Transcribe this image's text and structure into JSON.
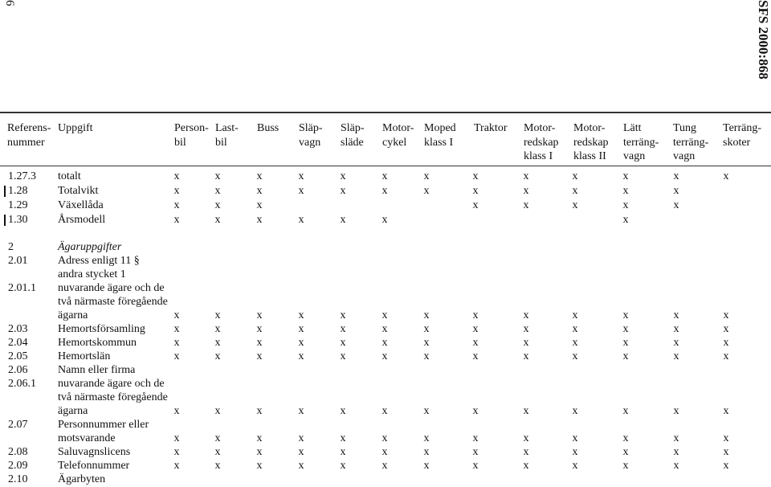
{
  "page_number": "6",
  "doc_id": "SFS 2000:868",
  "header": {
    "ref": "Referens-\nnummer",
    "task": "Uppgift",
    "columns": [
      "Person-\nbil",
      "Last-\nbil",
      "Buss",
      "Släp-\nvagn",
      "Släp-\nsläde",
      "Motor-\ncykel",
      "Moped\nklass I",
      "Traktor",
      "Motor-\nredskap\nklass I",
      "Motor-\nredskap\nklass II",
      "Lätt\nterräng-\nvagn",
      "Tung\nterräng-\nvagn",
      "Terräng-\nskoter"
    ]
  },
  "rows": [
    {
      "ref": "1.27.3",
      "lines": [
        "totalt"
      ],
      "marks": [
        "x",
        "x",
        "x",
        "x",
        "x",
        "x",
        "x",
        "x",
        "x",
        "x",
        "x",
        "x",
        "x"
      ]
    },
    {
      "ref": "1.28",
      "lines": [
        "Totalvikt"
      ],
      "changed": true,
      "marks": [
        "x",
        "x",
        "x",
        "x",
        "x",
        "x",
        "x",
        "x",
        "x",
        "x",
        "x",
        "x",
        ""
      ]
    },
    {
      "ref": "1.29",
      "lines": [
        "Växellåda"
      ],
      "marks": [
        "x",
        "x",
        "x",
        "",
        "",
        "",
        "",
        "x",
        "x",
        "x",
        "x",
        "x",
        ""
      ]
    },
    {
      "ref": "1.30",
      "lines": [
        "Årsmodell"
      ],
      "changed": true,
      "marks": [
        "x",
        "x",
        "x",
        "x",
        "x",
        "x",
        "",
        "",
        "",
        "",
        "x",
        "",
        ""
      ]
    },
    {
      "ref": "2",
      "lines": [
        "Ägaruppgifter"
      ],
      "section": true,
      "marks": []
    },
    {
      "ref": "2.01",
      "lines": [
        "Adress enligt 11 §",
        "andra stycket 1"
      ],
      "marks": []
    },
    {
      "ref": "2.01.1",
      "lines": [
        "nuvarande ägare och de",
        "två närmaste föregående",
        "ägarna"
      ],
      "marks": [
        "x",
        "x",
        "x",
        "x",
        "x",
        "x",
        "x",
        "x",
        "x",
        "x",
        "x",
        "x",
        "x"
      ]
    },
    {
      "ref": "2.03",
      "lines": [
        "Hemortsförsamling"
      ],
      "marks": [
        "x",
        "x",
        "x",
        "x",
        "x",
        "x",
        "x",
        "x",
        "x",
        "x",
        "x",
        "x",
        "x"
      ]
    },
    {
      "ref": "2.04",
      "lines": [
        "Hemortskommun"
      ],
      "marks": [
        "x",
        "x",
        "x",
        "x",
        "x",
        "x",
        "x",
        "x",
        "x",
        "x",
        "x",
        "x",
        "x"
      ]
    },
    {
      "ref": "2.05",
      "lines": [
        "Hemortslän"
      ],
      "marks": [
        "x",
        "x",
        "x",
        "x",
        "x",
        "x",
        "x",
        "x",
        "x",
        "x",
        "x",
        "x",
        "x"
      ]
    },
    {
      "ref": "2.06",
      "lines": [
        "Namn eller firma"
      ],
      "marks": []
    },
    {
      "ref": "2.06.1",
      "lines": [
        "nuvarande ägare och de",
        "två närmaste föregående",
        "ägarna"
      ],
      "marks": [
        "x",
        "x",
        "x",
        "x",
        "x",
        "x",
        "x",
        "x",
        "x",
        "x",
        "x",
        "x",
        "x"
      ]
    },
    {
      "ref": "2.07",
      "lines": [
        "Personnummer eller",
        "motsvarande"
      ],
      "marks": [
        "x",
        "x",
        "x",
        "x",
        "x",
        "x",
        "x",
        "x",
        "x",
        "x",
        "x",
        "x",
        "x"
      ]
    },
    {
      "ref": "2.08",
      "lines": [
        "Saluvagnslicens"
      ],
      "marks": [
        "x",
        "x",
        "x",
        "x",
        "x",
        "x",
        "x",
        "x",
        "x",
        "x",
        "x",
        "x",
        "x"
      ]
    },
    {
      "ref": "2.09",
      "lines": [
        "Telefonnummer"
      ],
      "marks": [
        "x",
        "x",
        "x",
        "x",
        "x",
        "x",
        "x",
        "x",
        "x",
        "x",
        "x",
        "x",
        "x"
      ]
    },
    {
      "ref": "2.10",
      "lines": [
        "Ägarbyten"
      ],
      "marks": []
    }
  ]
}
